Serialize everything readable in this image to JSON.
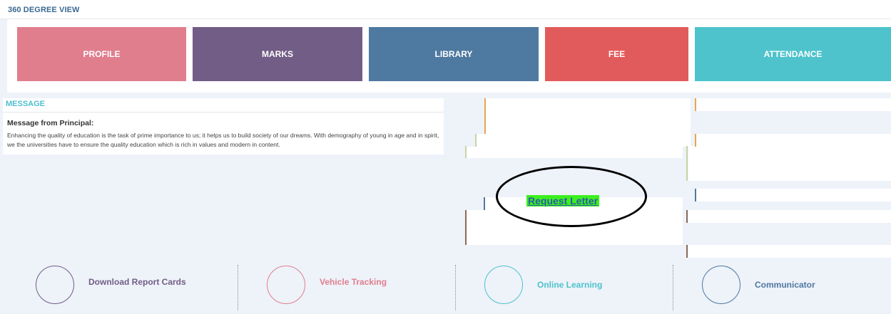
{
  "header": {
    "title": "360 DEGREE VIEW"
  },
  "tiles": [
    {
      "label": "PROFILE",
      "color": "#e07e8e"
    },
    {
      "label": "MARKS",
      "color": "#725d86"
    },
    {
      "label": "LIBRARY",
      "color": "#4e79a1"
    },
    {
      "label": "FEE",
      "color": "#e25b5c"
    },
    {
      "label": "ATTENDANCE",
      "color": "#4ec3cc"
    }
  ],
  "message": {
    "section_title": "MESSAGE",
    "heading": "Message from Principal:",
    "body": "Enhancing the quality of education is the task of prime importance to us; it helps us to build society of our dreams. With demography of young in age and in spirit, we the universities have to ensure the quality education which is rich in values and modern in content."
  },
  "request_link": {
    "label": "Request Letter",
    "highlight": "#3df01e",
    "annotation": "black-ellipse"
  },
  "quick_links": [
    {
      "label": "Download Report Cards",
      "color": "#725d86"
    },
    {
      "label": "Vehicle Tracking",
      "color": "#e07e8e"
    },
    {
      "label": "Online Learning",
      "color": "#4ec3cc"
    },
    {
      "label": "Communicator",
      "color": "#4e79a1"
    }
  ]
}
